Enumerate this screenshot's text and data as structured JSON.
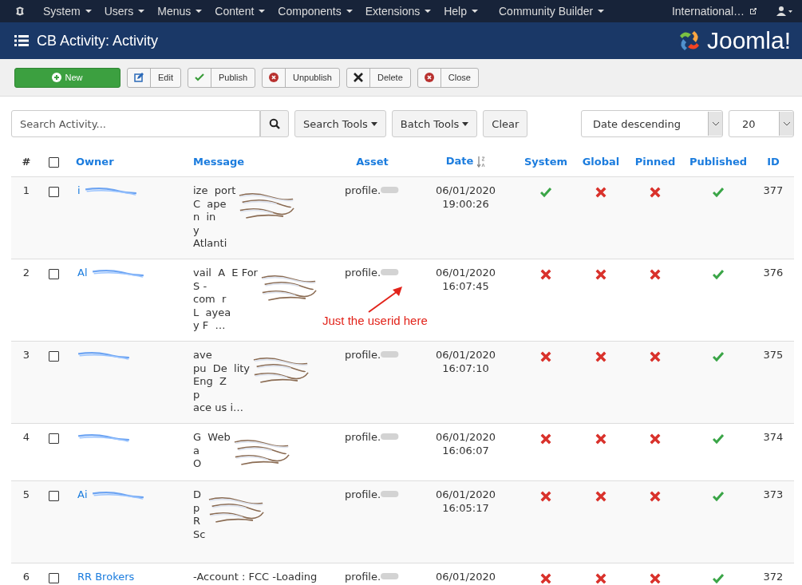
{
  "navbar": {
    "menus": [
      "System",
      "Users",
      "Menus",
      "Content",
      "Components",
      "Extensions",
      "Help",
      "Community Builder"
    ],
    "site_link": "International…"
  },
  "header": {
    "title": "CB Activity: Activity",
    "logo_text": "Joomla!"
  },
  "toolbar": [
    {
      "kind": "primary",
      "label": "New"
    },
    {
      "kind": "default",
      "label": "Edit"
    },
    {
      "kind": "default",
      "label": "Publish"
    },
    {
      "kind": "default",
      "label": "Unpublish"
    },
    {
      "kind": "default",
      "label": "Delete"
    },
    {
      "kind": "default",
      "label": "Close"
    }
  ],
  "filters": {
    "search": {
      "placeholder": "Search Activity..."
    },
    "buttons": [
      "Search Tools",
      "Batch Tools",
      "Clear"
    ],
    "ordering": "Date descending",
    "limit": "20"
  },
  "table": {
    "select_all_checked": false,
    "columns": [
      "#",
      "Owner",
      "Message",
      "Asset",
      "Date",
      "System",
      "Global",
      "Pinned",
      "Published",
      "ID"
    ],
    "rows": [
      {
        "num": "1",
        "checked": false,
        "owner": "i",
        "redacted": true,
        "message_lines": [
          "ize  port",
          "C  ape",
          "n  in",
          "y",
          "Atlanti"
        ],
        "asset": "profile.",
        "date": "06/01/2020",
        "time": "19:00:26",
        "system": true,
        "global": false,
        "pinned": false,
        "published": true,
        "id": "377"
      },
      {
        "num": "2",
        "checked": false,
        "owner": "Al",
        "redacted": true,
        "message_lines": [
          "vail  A  E For",
          "S -",
          "com  r",
          "L  ayea",
          "y F  …"
        ],
        "asset": "profile.",
        "date": "06/01/2020",
        "time": "16:07:45",
        "system": false,
        "global": false,
        "pinned": false,
        "published": true,
        "id": "376"
      },
      {
        "num": "3",
        "checked": false,
        "redacted": true,
        "message_lines": [
          "ave",
          "pu  De  lity",
          "Eng  Z",
          "p",
          "ace us i…"
        ],
        "asset": "profile.",
        "date": "06/01/2020",
        "time": "16:07:10",
        "system": false,
        "global": false,
        "pinned": false,
        "published": true,
        "id": "375"
      },
      {
        "num": "4",
        "checked": false,
        "redacted": true,
        "message_lines": [
          "G  Web",
          "a",
          "O"
        ],
        "asset": "profile.",
        "date": "06/01/2020",
        "time": "16:06:07",
        "system": false,
        "global": false,
        "pinned": false,
        "published": true,
        "id": "374"
      },
      {
        "num": "5",
        "checked": false,
        "owner": "Ai",
        "redacted": true,
        "message_lines": [
          "D",
          "p",
          "R",
          "Sc"
        ],
        "asset": "profile.",
        "date": "06/01/2020",
        "time": "16:05:17",
        "system": false,
        "global": false,
        "pinned": false,
        "published": true,
        "id": "373"
      },
      {
        "num": "6",
        "checked": false,
        "owner": "RR Brokers",
        "redacted": false,
        "message_lines": [
          "-Account : FCC -Loading"
        ],
        "asset": "profile.",
        "date": "06/01/2020",
        "system": false,
        "global": false,
        "pinned": false,
        "published": true,
        "id": "372"
      }
    ]
  },
  "annotation": {
    "text": "Just the userid here"
  }
}
